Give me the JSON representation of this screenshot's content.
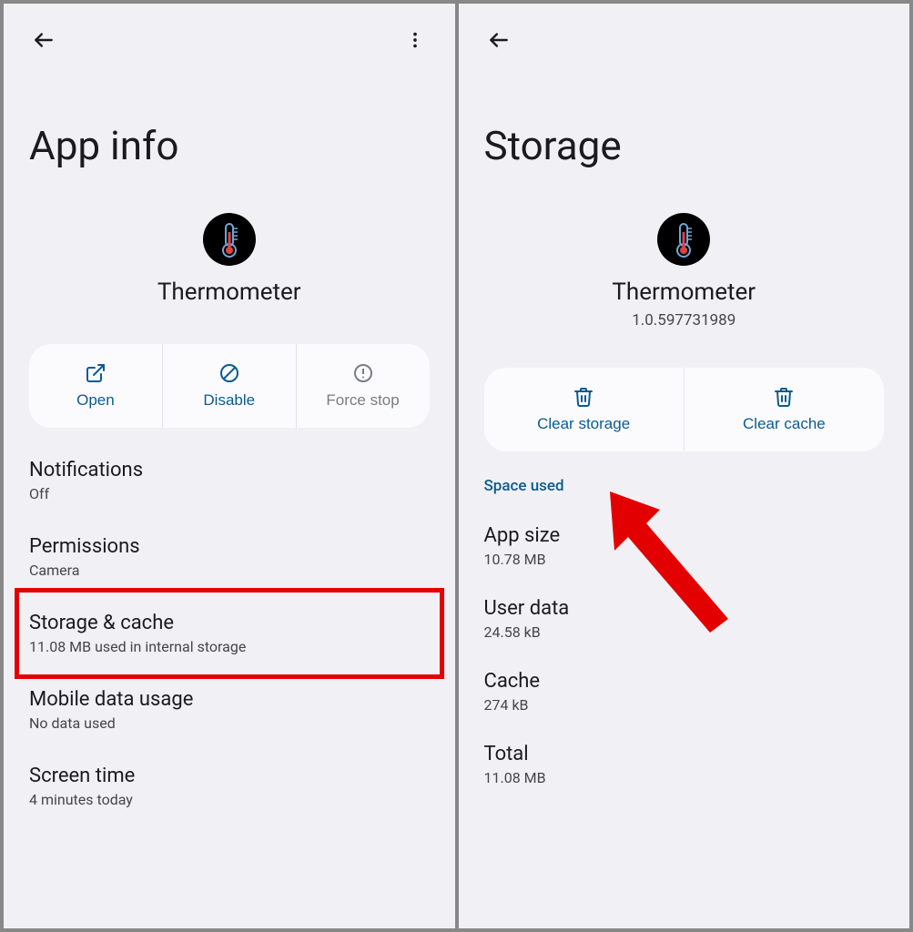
{
  "left": {
    "title": "App info",
    "app_name": "Thermometer",
    "actions": {
      "open": "Open",
      "disable": "Disable",
      "forcestop": "Force stop"
    },
    "items": [
      {
        "title": "Notifications",
        "sub": "Off"
      },
      {
        "title": "Permissions",
        "sub": "Camera"
      },
      {
        "title": "Storage & cache",
        "sub": "11.08 MB used in internal storage",
        "highlighted": true
      },
      {
        "title": "Mobile data usage",
        "sub": "No data used"
      },
      {
        "title": "Screen time",
        "sub": "4 minutes today"
      }
    ]
  },
  "right": {
    "title": "Storage",
    "app_name": "Thermometer",
    "app_version": "1.0.597731989",
    "actions": {
      "clear_storage": "Clear storage",
      "clear_cache": "Clear cache"
    },
    "section_header": "Space used",
    "stats": [
      {
        "title": "App size",
        "sub": "10.78 MB"
      },
      {
        "title": "User data",
        "sub": "24.58 kB"
      },
      {
        "title": "Cache",
        "sub": "274 kB"
      },
      {
        "title": "Total",
        "sub": "11.08 MB"
      }
    ]
  }
}
